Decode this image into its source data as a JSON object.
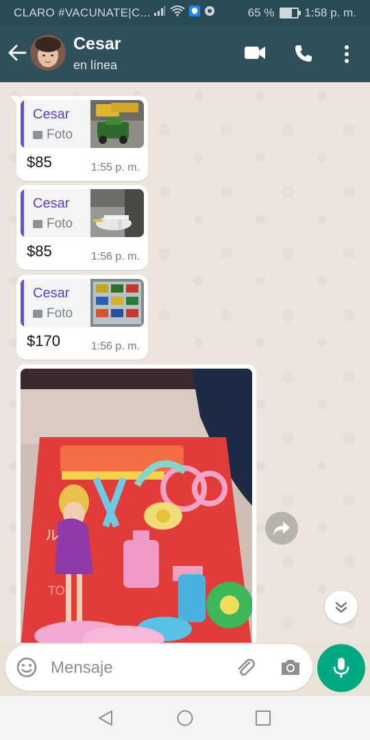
{
  "status_bar": {
    "carrier": "CLARO #VACUNATE|C...",
    "battery": "65 %",
    "battery_level": 0.65,
    "time": "1:58 p. m."
  },
  "header": {
    "contact_name": "Cesar",
    "contact_status": "en línea"
  },
  "messages": [
    {
      "quote_name": "Cesar",
      "quote_type": "Foto",
      "text": "$85",
      "time": "1:55 p. m."
    },
    {
      "quote_name": "Cesar",
      "quote_type": "Foto",
      "text": "$85",
      "time": "1:56 p. m."
    },
    {
      "quote_name": "Cesar",
      "quote_type": "Foto",
      "text": "$170",
      "time": "1:56 p. m."
    }
  ],
  "composer": {
    "placeholder": "Mensaje"
  },
  "colors": {
    "header": "#2f4f5a",
    "status_bar": "#294b56",
    "accent_green": "#00a884",
    "quote_name": "#5a43c9"
  }
}
